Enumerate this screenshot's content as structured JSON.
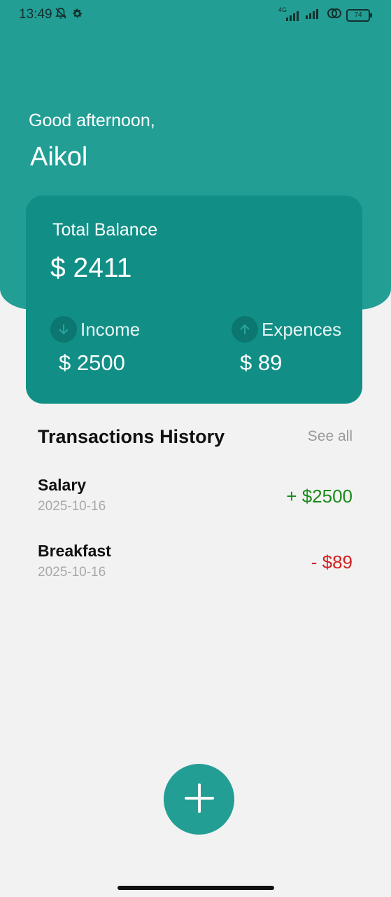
{
  "status_bar": {
    "time": "13:49",
    "network_label": "4G",
    "battery_level": "74",
    "icons": [
      "bell-off-icon",
      "gear-icon",
      "signal-icon",
      "signal-icon",
      "link-icon",
      "battery-icon"
    ]
  },
  "header": {
    "greeting": "Good afternoon,",
    "username": "Aikol"
  },
  "balance_card": {
    "label": "Total Balance",
    "value": "$ 2411",
    "income": {
      "label": "Income",
      "value": "$ 2500",
      "icon": "arrow-down-icon"
    },
    "expenses": {
      "label": "Expences",
      "value": "$ 89",
      "icon": "arrow-up-icon"
    }
  },
  "transactions": {
    "title": "Transactions History",
    "see_all_label": "See all",
    "items": [
      {
        "name": "Salary",
        "date": "2025-10-16",
        "amount": "+ $2500",
        "color": "#1a8a1a"
      },
      {
        "name": "Breakfast",
        "date": "2025-10-16",
        "amount": "- $89",
        "color": "#d42020"
      }
    ]
  },
  "fab": {
    "icon": "plus-icon"
  },
  "colors": {
    "primary": "#229e95",
    "card": "#118f86",
    "background": "#f2f2f2",
    "income_green": "#1a8a1a",
    "expense_red": "#d42020"
  }
}
